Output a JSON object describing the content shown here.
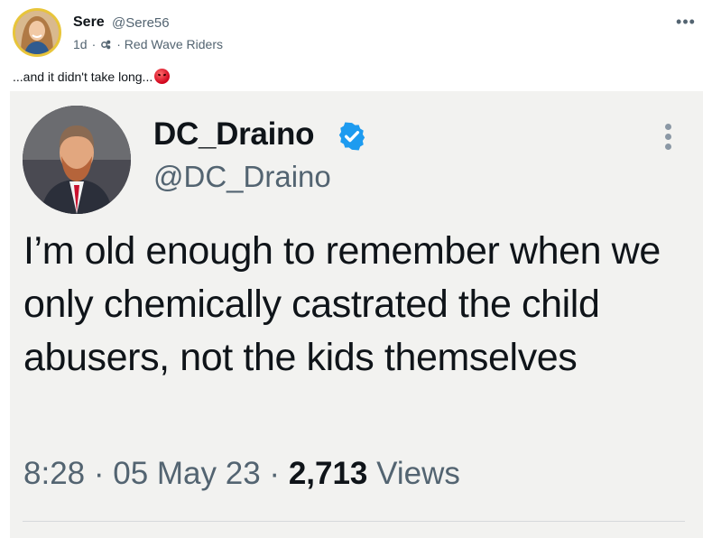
{
  "post": {
    "author_name": "Sere",
    "author_handle": "@Sere56",
    "time": "1d",
    "separator": "·",
    "community": "· Red Wave Riders",
    "more_icon": "ellipsis-icon",
    "text": "...and it didn't take long...",
    "emoji": "angry-face-emoji"
  },
  "embedded": {
    "name": "DC_Draino",
    "handle": "@DC_Draino",
    "verified_color": "#1d9bf0",
    "text": "I’m old enough to remember when we only chemically castrated the child abusers, not the kids themselves",
    "time": "8:28",
    "date": "05 May 23",
    "dot": "·",
    "views_count": "2,713",
    "views_label": "Views"
  }
}
